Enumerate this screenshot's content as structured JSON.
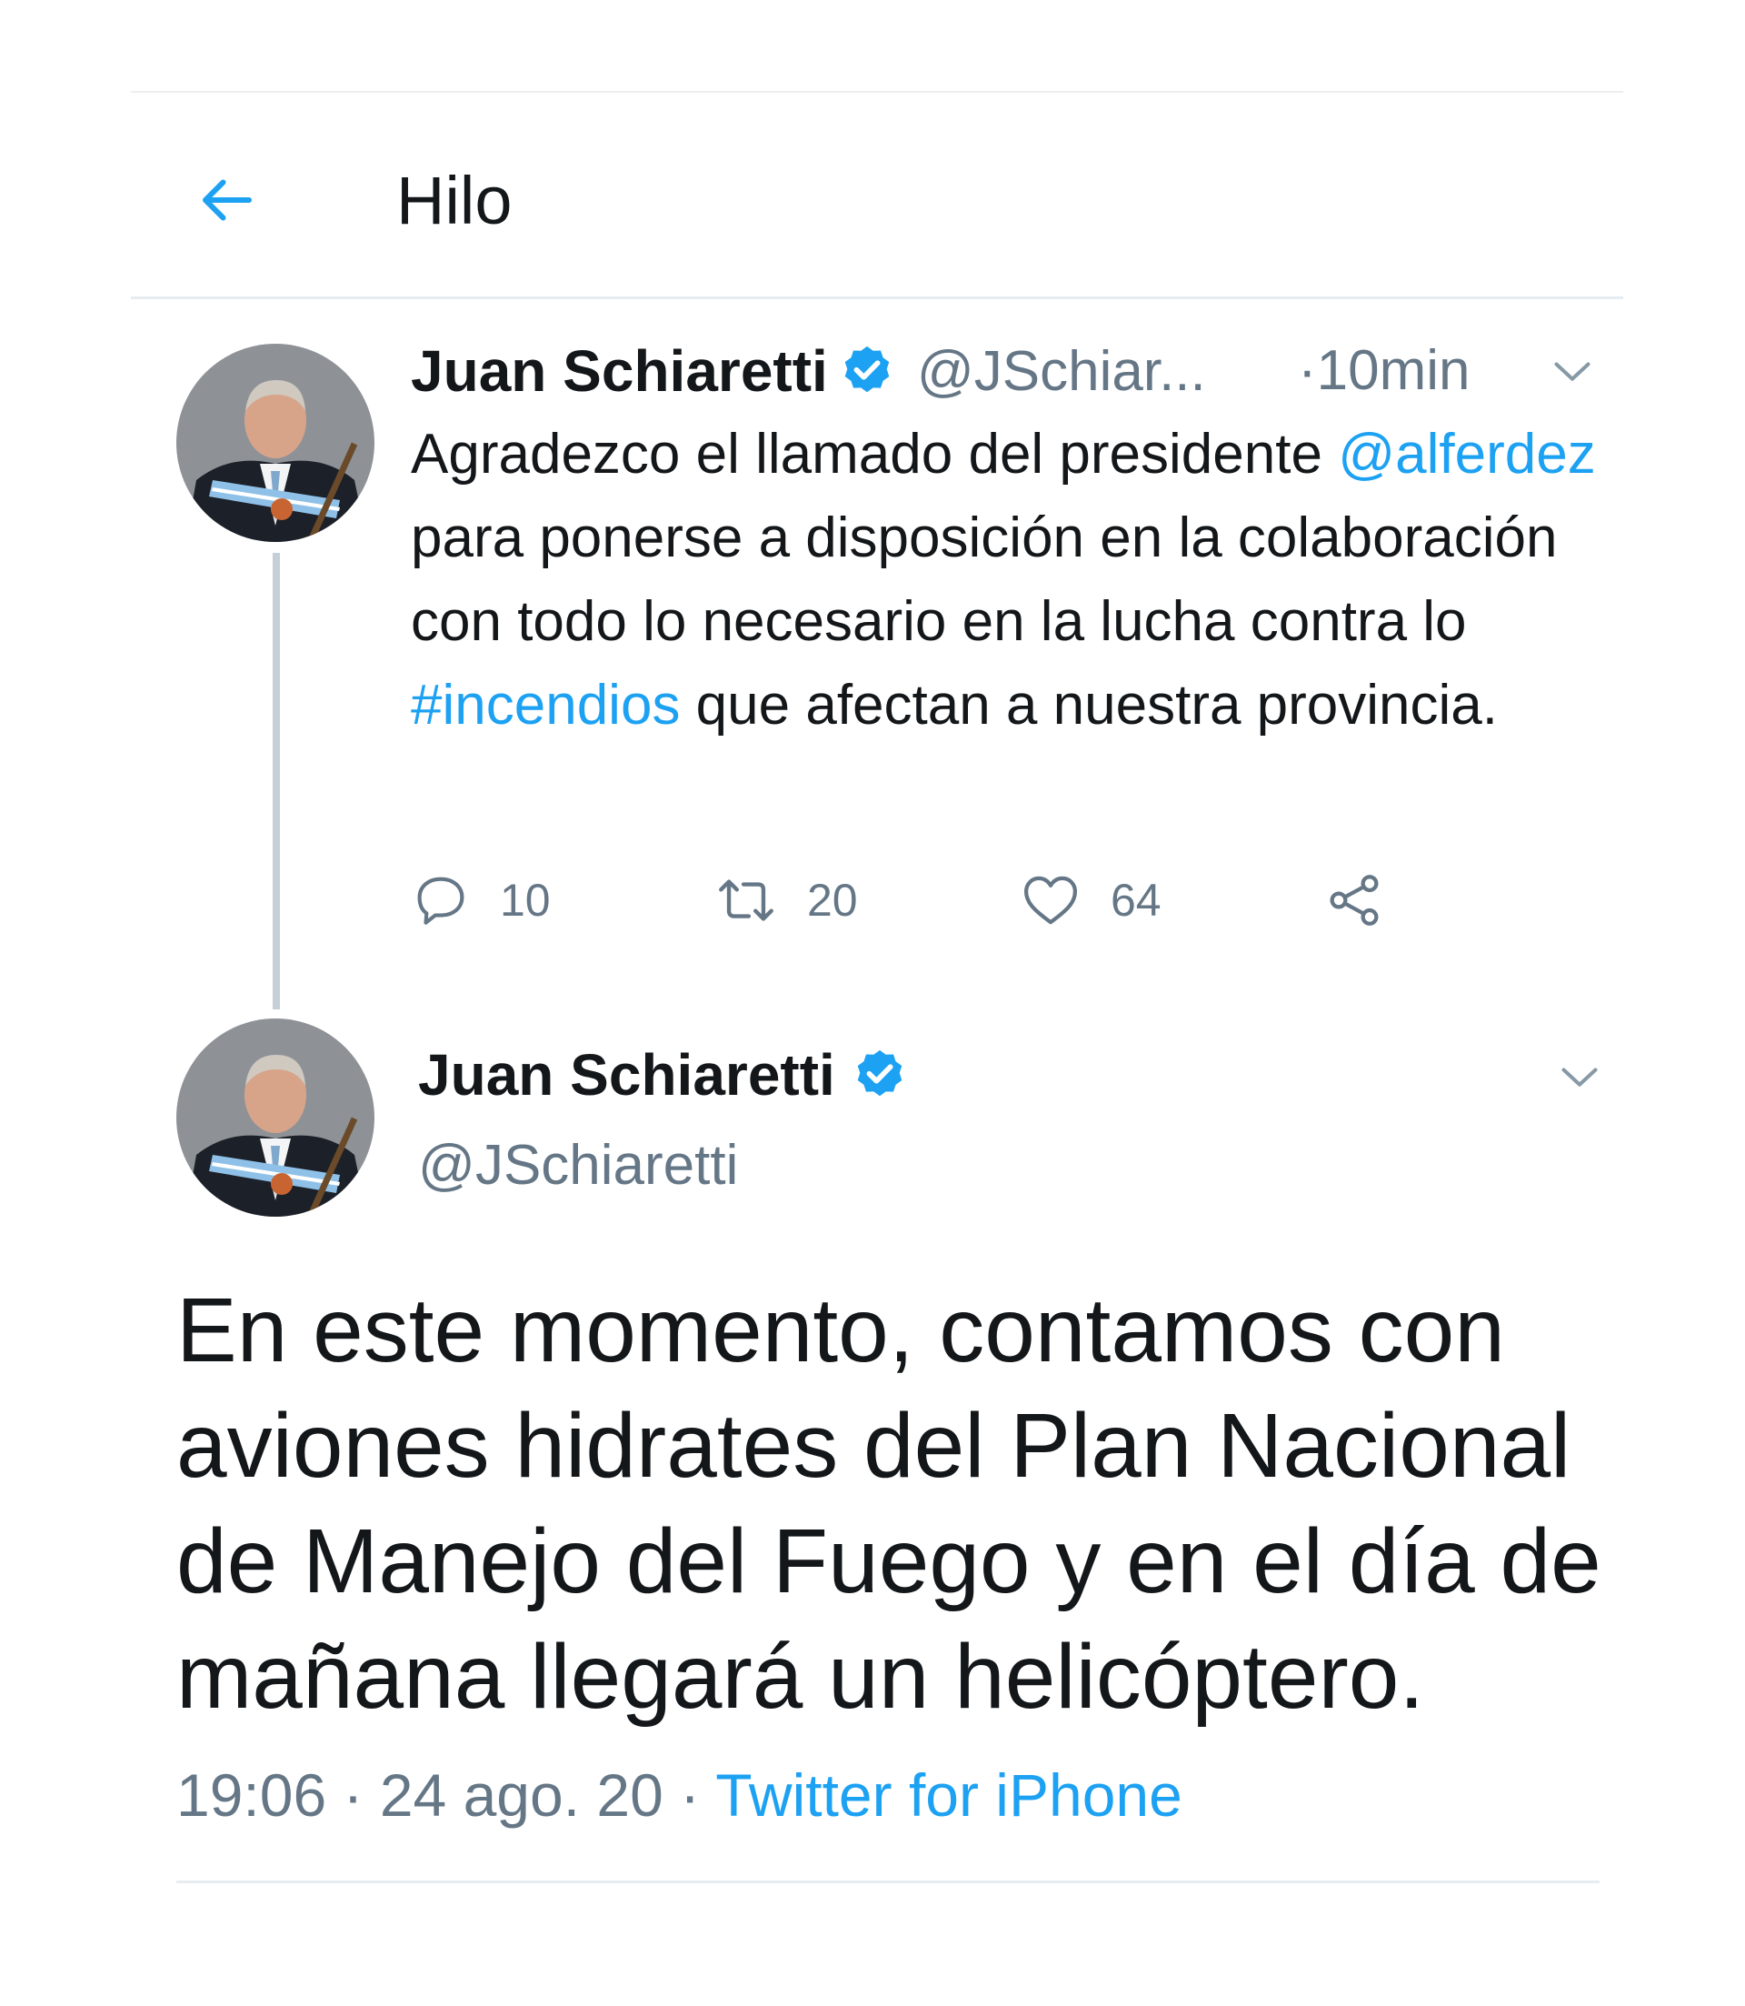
{
  "header": {
    "back_icon": "arrow-left-icon",
    "title": "Hilo"
  },
  "colors": {
    "accent": "#1da1f2",
    "text": "#14171a",
    "muted": "#657786",
    "thread_line": "#c4cfd6"
  },
  "tweet1": {
    "name": "Juan Schiaretti",
    "verified": true,
    "handle": "@JSchiar...",
    "separator": "·",
    "time": "10min",
    "body_parts": [
      "Agradezco el llamado del presidente ",
      "@alferdez",
      " para ponerse a disposición en la colaboración con todo lo necesario en la lucha contra lo ",
      "#incendios",
      " que afectan a nuestra provincia."
    ],
    "actions": {
      "replies": "10",
      "retweets": "20",
      "likes": "64"
    }
  },
  "tweet2": {
    "name": "Juan Schiaretti",
    "verified": true,
    "handle": "@JSchiaretti",
    "body": "En este momento, contamos con aviones hidrates del Plan Nacional de Manejo del Fuego y en el día de mañana llegará un helicóptero.",
    "time": "19:06",
    "sep1": " · ",
    "date": "24 ago. 20",
    "sep2": " · ",
    "source": "Twitter for iPhone"
  }
}
